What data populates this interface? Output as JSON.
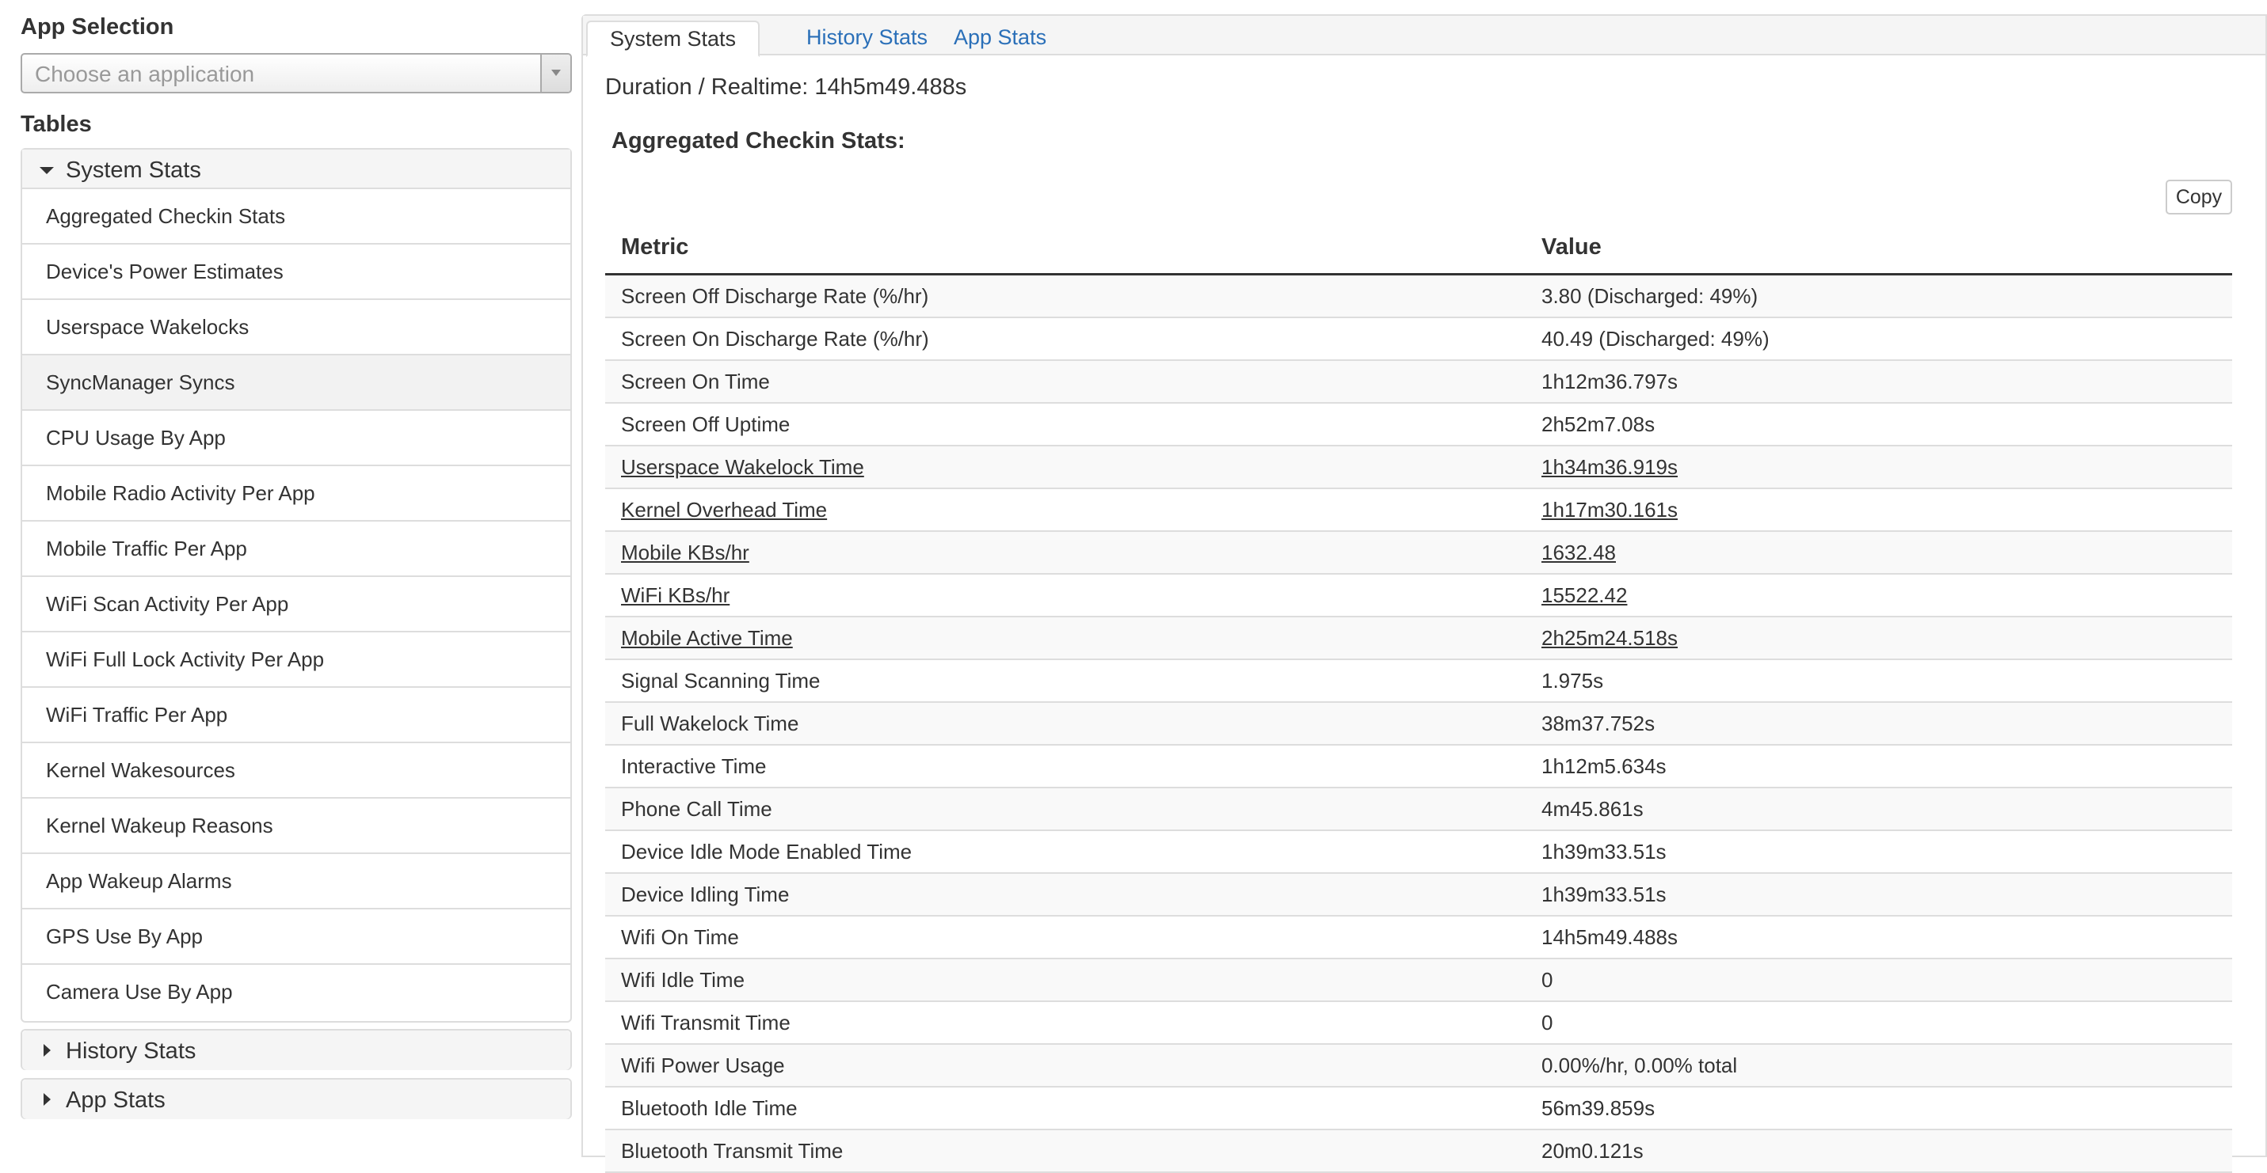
{
  "sidebar": {
    "app_selection_heading": "App Selection",
    "app_select_placeholder": "Choose an application",
    "tables_heading": "Tables",
    "system_panel": {
      "title": "System Stats",
      "items": [
        "Aggregated Checkin Stats",
        "Device's Power Estimates",
        "Userspace Wakelocks",
        "SyncManager Syncs",
        "CPU Usage By App",
        "Mobile Radio Activity Per App",
        "Mobile Traffic Per App",
        "WiFi Scan Activity Per App",
        "WiFi Full Lock Activity Per App",
        "WiFi Traffic Per App",
        "Kernel Wakesources",
        "Kernel Wakeup Reasons",
        "App Wakeup Alarms",
        "GPS Use By App",
        "Camera Use By App"
      ]
    },
    "history_panel": {
      "title": "History Stats"
    },
    "app_panel": {
      "title": "App Stats"
    }
  },
  "main": {
    "tabs": [
      "System Stats",
      "History Stats",
      "App Stats"
    ],
    "duration": "Duration / Realtime: 14h5m49.488s",
    "section_title": "Aggregated Checkin Stats:",
    "copy_label": "Copy",
    "columns": {
      "metric": "Metric",
      "value": "Value"
    },
    "rows": [
      {
        "metric": "Screen Off Discharge Rate (%/hr)",
        "value": "3.80 (Discharged: 49%)",
        "link": false
      },
      {
        "metric": "Screen On Discharge Rate (%/hr)",
        "value": "40.49 (Discharged: 49%)",
        "link": false
      },
      {
        "metric": "Screen On Time",
        "value": "1h12m36.797s",
        "link": false
      },
      {
        "metric": "Screen Off Uptime",
        "value": "2h52m7.08s",
        "link": false
      },
      {
        "metric": "Userspace Wakelock Time",
        "value": "1h34m36.919s",
        "link": true
      },
      {
        "metric": "Kernel Overhead Time",
        "value": "1h17m30.161s",
        "link": true
      },
      {
        "metric": "Mobile KBs/hr",
        "value": "1632.48",
        "link": true
      },
      {
        "metric": "WiFi KBs/hr",
        "value": "15522.42",
        "link": true
      },
      {
        "metric": "Mobile Active Time",
        "value": "2h25m24.518s",
        "link": true
      },
      {
        "metric": "Signal Scanning Time",
        "value": "1.975s",
        "link": false
      },
      {
        "metric": "Full Wakelock Time",
        "value": "38m37.752s",
        "link": false
      },
      {
        "metric": "Interactive Time",
        "value": "1h12m5.634s",
        "link": false
      },
      {
        "metric": "Phone Call Time",
        "value": "4m45.861s",
        "link": false
      },
      {
        "metric": "Device Idle Mode Enabled Time",
        "value": "1h39m33.51s",
        "link": false
      },
      {
        "metric": "Device Idling Time",
        "value": "1h39m33.51s",
        "link": false
      },
      {
        "metric": "Wifi On Time",
        "value": "14h5m49.488s",
        "link": false
      },
      {
        "metric": "Wifi Idle Time",
        "value": "0",
        "link": false
      },
      {
        "metric": "Wifi Transmit Time",
        "value": "0",
        "link": false
      },
      {
        "metric": "Wifi Power Usage",
        "value": "0.00%/hr, 0.00% total",
        "link": false
      },
      {
        "metric": "Bluetooth Idle Time",
        "value": "56m39.859s",
        "link": false
      },
      {
        "metric": "Bluetooth Transmit Time",
        "value": "20m0.121s",
        "link": false
      }
    ]
  }
}
